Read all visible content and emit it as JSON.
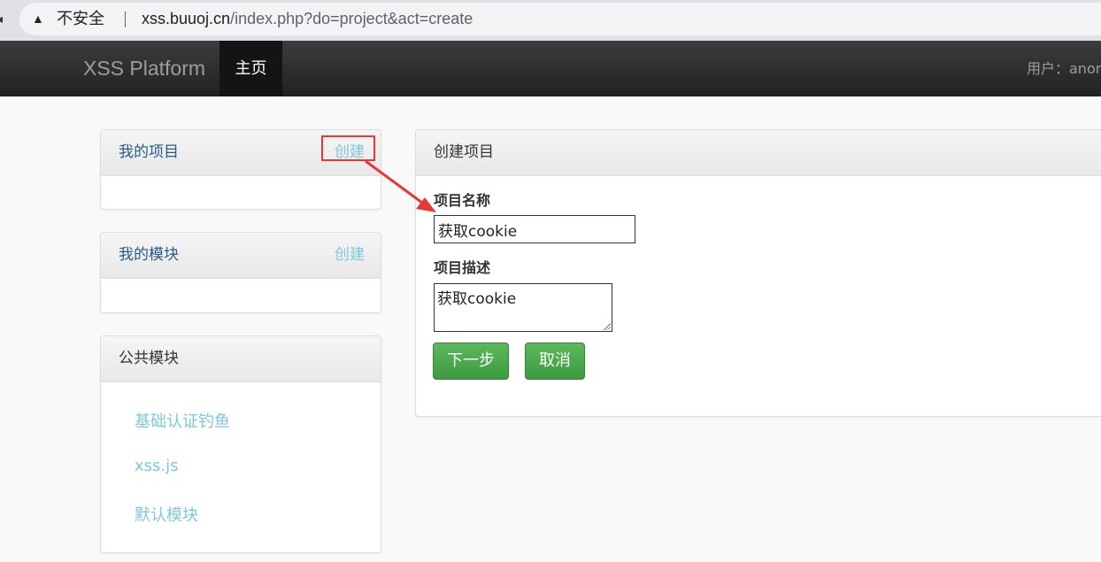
{
  "browser": {
    "insecure_label": "不安全",
    "url_host": "xss.buuoj.cn",
    "url_path": "/index.php?do=project&act=create"
  },
  "navbar": {
    "brand": "XSS Platform",
    "home": "主页",
    "user": "用户：anon"
  },
  "sidebar": {
    "my_projects": {
      "title": "我的项目",
      "create": "创建"
    },
    "my_modules": {
      "title": "我的模块",
      "create": "创建"
    },
    "public_modules": {
      "title": "公共模块",
      "items": [
        "基础认证钓鱼",
        "xss.js",
        "默认模块"
      ]
    }
  },
  "create_project": {
    "heading": "创建项目",
    "name_label": "项目名称",
    "name_value": "获取cookie",
    "desc_label": "项目描述",
    "desc_value": "获取cookie",
    "next_button": "下一步",
    "cancel_button": "取消"
  },
  "annotation": {
    "highlight_color": "#e53935"
  }
}
